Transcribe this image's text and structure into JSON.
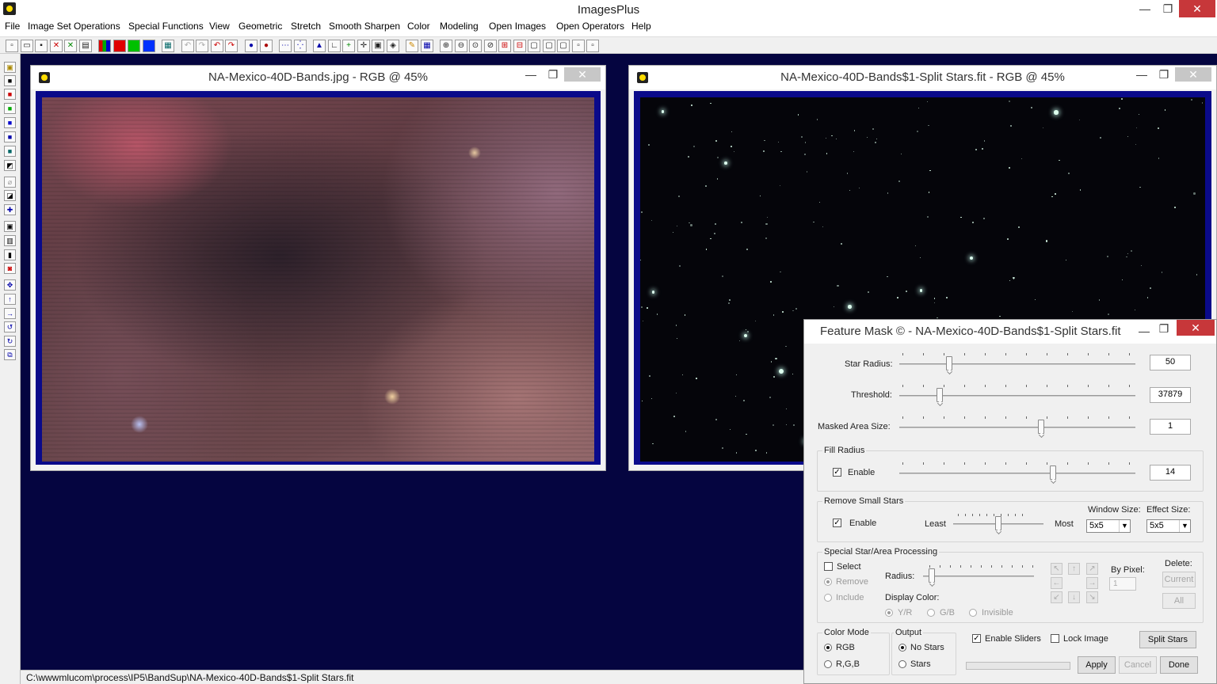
{
  "app": {
    "title": "ImagesPlus",
    "minimize": "—",
    "maximize": "❐",
    "close": "✕"
  },
  "menu": [
    "File",
    "Image Set Operations",
    "Special Functions",
    "View",
    "Geometric",
    "Stretch",
    "Smooth Sharpen",
    "Color",
    "Modeling",
    "Open Images",
    "Open Operators",
    "Help"
  ],
  "windows": {
    "left": {
      "title": "NA-Mexico-40D-Bands.jpg - RGB @ 45%",
      "minimize": "—",
      "maximize": "❐",
      "close": "✕"
    },
    "right": {
      "title": "NA-Mexico-40D-Bands$1-Split Stars.fit - RGB @ 45%",
      "minimize": "—",
      "maximize": "❐",
      "close": "✕"
    }
  },
  "status_path": "C:\\wwwmlucom\\process\\IP5\\BandSup\\NA-Mexico-40D-Bands$1-Split Stars.fit",
  "dialog": {
    "title": "Feature Mask © - NA-Mexico-40D-Bands$1-Split Stars.fit",
    "minimize": "—",
    "maximize": "❐",
    "close": "✕",
    "star_radius": {
      "label": "Star Radius:",
      "value": "50",
      "level": 0.21
    },
    "threshold": {
      "label": "Threshold:",
      "value": "37879",
      "level": 0.17
    },
    "masked_area": {
      "label": "Masked Area Size:",
      "value": "1",
      "level": 0.6
    },
    "fill_radius": {
      "group": "Fill Radius",
      "enable": "Enable",
      "enable_checked": true,
      "value": "14",
      "level": 0.65
    },
    "remove_small": {
      "group": "Remove Small Stars",
      "enable": "Enable",
      "enable_checked": true,
      "least": "Least",
      "most": "Most",
      "level": 0.5,
      "window_size_label": "Window Size:",
      "window_size": "5x5",
      "effect_size_label": "Effect Size:",
      "effect_size": "5x5"
    },
    "special": {
      "group": "Special Star/Area Processing",
      "select": "Select",
      "remove": "Remove",
      "include": "Include",
      "radius": "Radius:",
      "display_color": "Display Color:",
      "yr": "Y/R",
      "gb": "G/B",
      "invisible": "Invisible",
      "by_pixel": "By Pixel:",
      "by_pixel_value": "1",
      "delete": "Delete:",
      "current": "Current",
      "all": "All",
      "radius_level": 0.08
    },
    "color_mode": {
      "group": "Color Mode",
      "rgb": "RGB",
      "r_g_b": "R,G,B"
    },
    "output": {
      "group": "Output",
      "no_stars": "No Stars",
      "stars": "Stars"
    },
    "enable_sliders": "Enable Sliders",
    "lock_image": "Lock Image",
    "buttons": {
      "split_stars": "Split Stars",
      "apply": "Apply",
      "cancel": "Cancel",
      "done": "Done"
    }
  }
}
